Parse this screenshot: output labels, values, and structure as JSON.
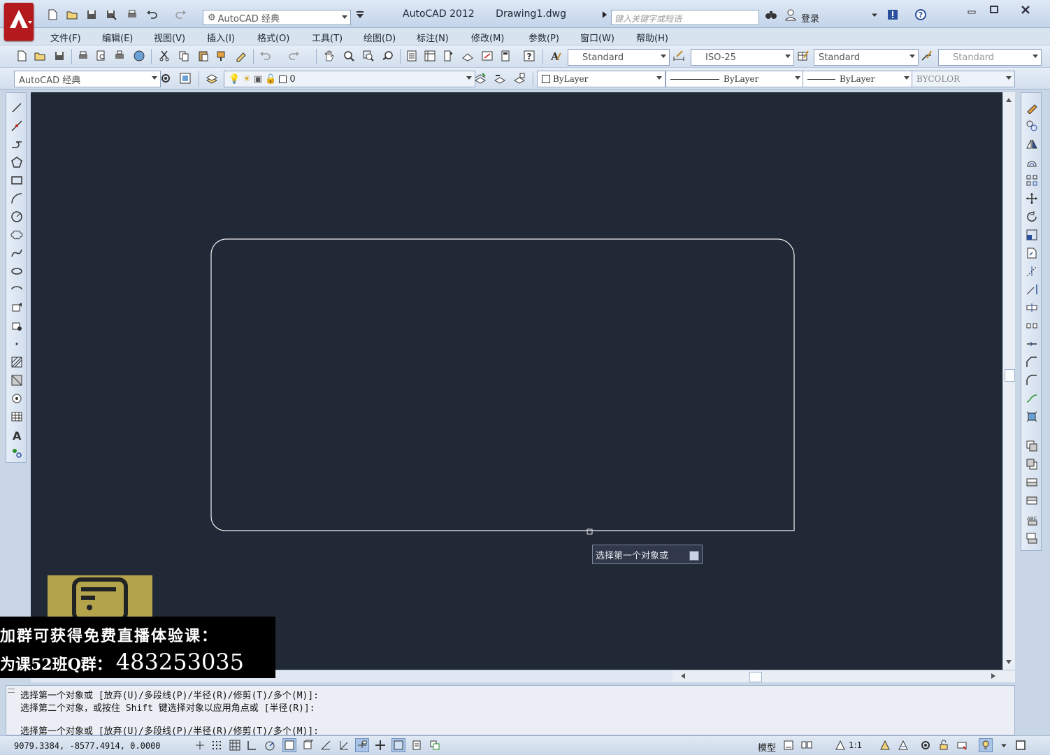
{
  "titlebar": {
    "workspace": "AutoCAD 经典",
    "app_name": "AutoCAD 2012",
    "file_name": "Drawing1.dwg",
    "search_placeholder": "键入关键字或短语",
    "login_label": "登录"
  },
  "menu": [
    "文件(F)",
    "编辑(E)",
    "视图(V)",
    "插入(I)",
    "格式(O)",
    "工具(T)",
    "绘图(D)",
    "标注(N)",
    "修改(M)",
    "参数(P)",
    "窗口(W)",
    "帮助(H)"
  ],
  "toolbar1": {
    "text_style": "Standard",
    "dim_style": "ISO-25",
    "table_style": "Standard",
    "mleader_style": "Standard"
  },
  "toolbar2": {
    "workspace": "AutoCAD 经典",
    "layer": "0",
    "color": "ByLayer",
    "linetype": "ByLayer",
    "lineweight": "ByLayer",
    "plotstyle": "BYCOLOR"
  },
  "tooltip": {
    "prompt": "选择第一个对象或"
  },
  "promo": {
    "line1": "加群可获得免费直播体验课：",
    "line2": "为课52班Q群：",
    "number": "483253035"
  },
  "command": {
    "line1": "选择第一个对象或 [放弃(U)/多段线(P)/半径(R)/修剪(T)/多个(M)]:",
    "line2": "选择第二个对象，或按住 Shift 键选择对象以应用角点或 [半径(R)]:",
    "line3": "选择第一个对象或 [放弃(U)/多段线(P)/半径(R)/修剪(T)/多个(M)]:"
  },
  "status": {
    "coords": "9079.3384,  -8577.4914,  0.0000",
    "model_label": "模型",
    "scale": "1:1"
  },
  "colors": {
    "canvas": "#212836",
    "brand": "#b3191d"
  }
}
